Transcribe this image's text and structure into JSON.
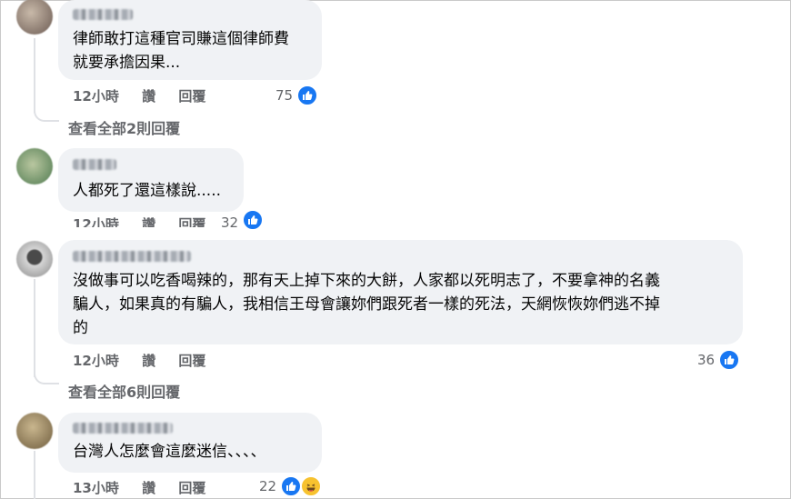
{
  "comments": [
    {
      "text": "律師敢打這種官司賺這個律師費\n就要承擔因果...",
      "time": "12小時",
      "like_label": "讚",
      "reply_label": "回覆",
      "likes": "75",
      "view_all": "查看全部2則回覆",
      "avatar_colors": [
        "#6b5a52",
        "#c8b9a9"
      ]
    },
    {
      "text": "人都死了還這樣說.....",
      "time": "12小時",
      "like_label": "讚",
      "reply_label": "回覆",
      "likes": "32",
      "avatar_colors": [
        "#4f7a50",
        "#b9c7a0"
      ]
    },
    {
      "text": "沒做事可以吃香喝辣的，那有天上掉下來的大餅，人家都以死明志了，不要拿神的名義\n騙人，如果真的有騙人，我相信王母會讓妳們跟死者一樣的死法，天網恢恢妳們逃不掉\n的",
      "time": "12小時",
      "like_label": "讚",
      "reply_label": "回覆",
      "likes": "36",
      "view_all": "查看全部6則回覆",
      "avatar_colors": [
        "#8a8a8a",
        "#d6d6d6"
      ]
    },
    {
      "text": "台灣人怎麼會這麼迷信、、、、",
      "time": "13小時",
      "like_label": "讚",
      "reply_label": "回覆",
      "likes": "22",
      "avatar_colors": [
        "#6f5d3e",
        "#c9b68e"
      ]
    }
  ],
  "colors": {
    "bubble": "#f0f2f5",
    "meta": "#65676b",
    "like": "#1877f2",
    "haha": "#f7c22f"
  }
}
